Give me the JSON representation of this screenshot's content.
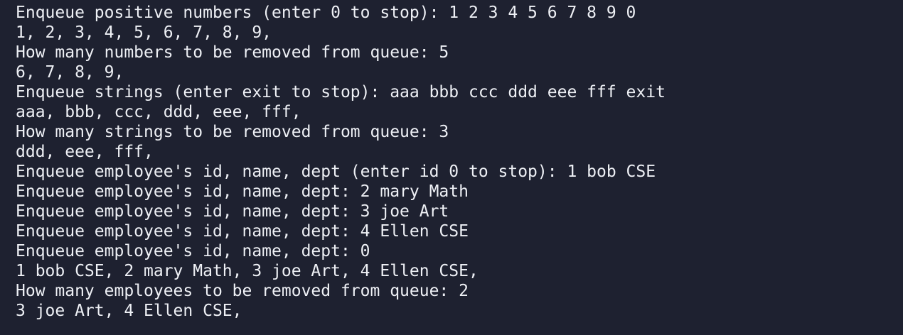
{
  "terminal": {
    "lines": [
      "Enqueue positive numbers (enter 0 to stop): 1 2 3 4 5 6 7 8 9 0",
      "1, 2, 3, 4, 5, 6, 7, 8, 9,",
      "How many numbers to be removed from queue: 5",
      "6, 7, 8, 9,",
      "Enqueue strings (enter exit to stop): aaa bbb ccc ddd eee fff exit",
      "aaa, bbb, ccc, ddd, eee, fff,",
      "How many strings to be removed from queue: 3",
      "ddd, eee, fff,",
      "Enqueue employee's id, name, dept (enter id 0 to stop): 1 bob CSE",
      "Enqueue employee's id, name, dept: 2 mary Math",
      "Enqueue employee's id, name, dept: 3 joe Art",
      "Enqueue employee's id, name, dept: 4 Ellen CSE",
      "Enqueue employee's id, name, dept: 0",
      "1 bob CSE, 2 mary Math, 3 joe Art, 4 Ellen CSE,",
      "How many employees to be removed from queue: 2",
      "3 joe Art, 4 Ellen CSE,"
    ]
  },
  "colors": {
    "background": "#1e2130",
    "text": "#eef0f5"
  }
}
